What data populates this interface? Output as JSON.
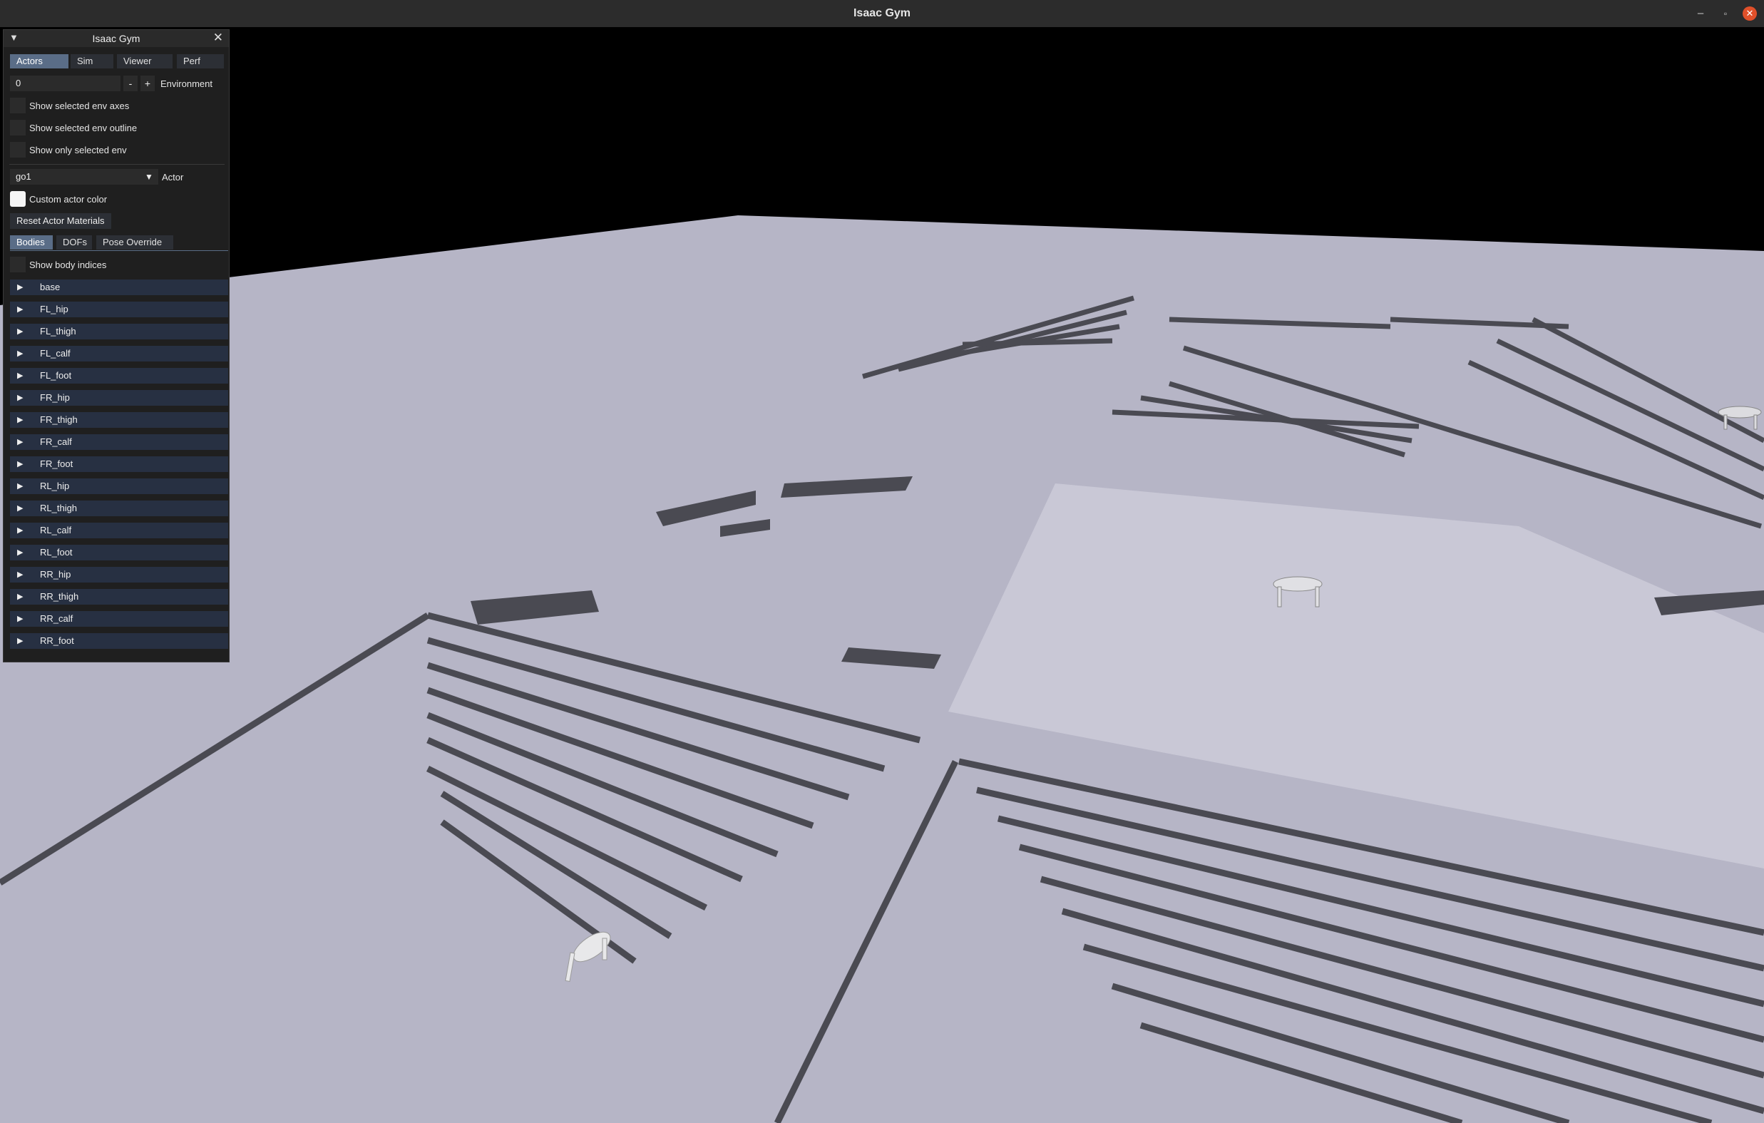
{
  "window": {
    "title": "Isaac Gym",
    "controls": {
      "minimize": "–",
      "maximize": "▫",
      "close": "✕"
    }
  },
  "panel": {
    "title": "Isaac Gym",
    "collapse_icon": "▼",
    "close_icon": "✕",
    "tabs": [
      "Actors",
      "Sim",
      "Viewer",
      "Perf"
    ],
    "active_tab": "Actors",
    "environment": {
      "value": "0",
      "minus": "-",
      "plus": "+",
      "label": "Environment"
    },
    "options": [
      {
        "label": "Show selected env axes",
        "checked": false
      },
      {
        "label": "Show selected env outline",
        "checked": false
      },
      {
        "label": "Show only selected env",
        "checked": false
      }
    ],
    "actor": {
      "value": "go1",
      "label": "Actor"
    },
    "custom_actor_color": {
      "label": "Custom actor color",
      "swatch": "#ffffff"
    },
    "reset_button": "Reset Actor Materials",
    "subtabs": [
      "Bodies",
      "DOFs",
      "Pose Override"
    ],
    "active_subtab": "Bodies",
    "show_body_indices": "Show body indices",
    "bodies": [
      "base",
      "FL_hip",
      "FL_thigh",
      "FL_calf",
      "FL_foot",
      "FR_hip",
      "FR_thigh",
      "FR_calf",
      "FR_foot",
      "RL_hip",
      "RL_thigh",
      "RL_calf",
      "RL_foot",
      "RR_hip",
      "RR_thigh",
      "RR_calf",
      "RR_foot"
    ]
  },
  "colors": {
    "terrain": "#b6b5c6",
    "groove": "#4a4a52",
    "sky": "#000000",
    "tab_active": "#5a6d87",
    "tree_row": "#273042",
    "close_button": "#e0502a"
  }
}
